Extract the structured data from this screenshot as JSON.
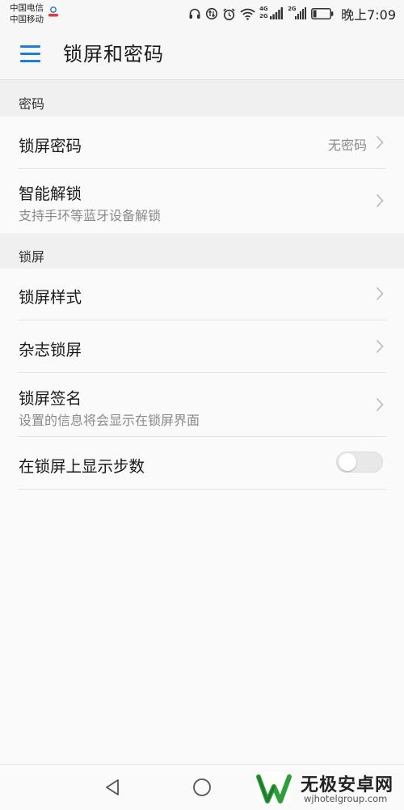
{
  "status_bar": {
    "carrier_1": "中国电信",
    "carrier_2": "中国移动",
    "network_1": "4G",
    "network_2": "2G",
    "network_3": "2G",
    "time": "晚上7:09",
    "icons": [
      "headset-icon",
      "data-saver-icon",
      "alarm-icon",
      "wifi-icon",
      "signal-icon",
      "signal-icon",
      "battery-icon"
    ],
    "battery_level": 0.2
  },
  "header": {
    "title": "锁屏和密码",
    "accent_color": "#1e7fd6"
  },
  "sections": {
    "password": {
      "header": "密码",
      "lock_password": {
        "label": "锁屏密码",
        "value": "无密码"
      },
      "smart_unlock": {
        "label": "智能解锁",
        "subtitle": "支持手环等蓝牙设备解锁"
      }
    },
    "lockscreen": {
      "header": "锁屏",
      "style": {
        "label": "锁屏样式"
      },
      "magazine": {
        "label": "杂志锁屏"
      },
      "signature": {
        "label": "锁屏签名",
        "subtitle": "设置的信息将会显示在锁屏界面"
      },
      "show_steps": {
        "label": "在锁屏上显示步数",
        "enabled": false
      }
    }
  },
  "nav": {
    "icons": [
      "back-icon",
      "home-icon"
    ]
  },
  "watermark": {
    "main_text": "无极安卓网",
    "sub_text": "wjhotelgroup.com"
  }
}
